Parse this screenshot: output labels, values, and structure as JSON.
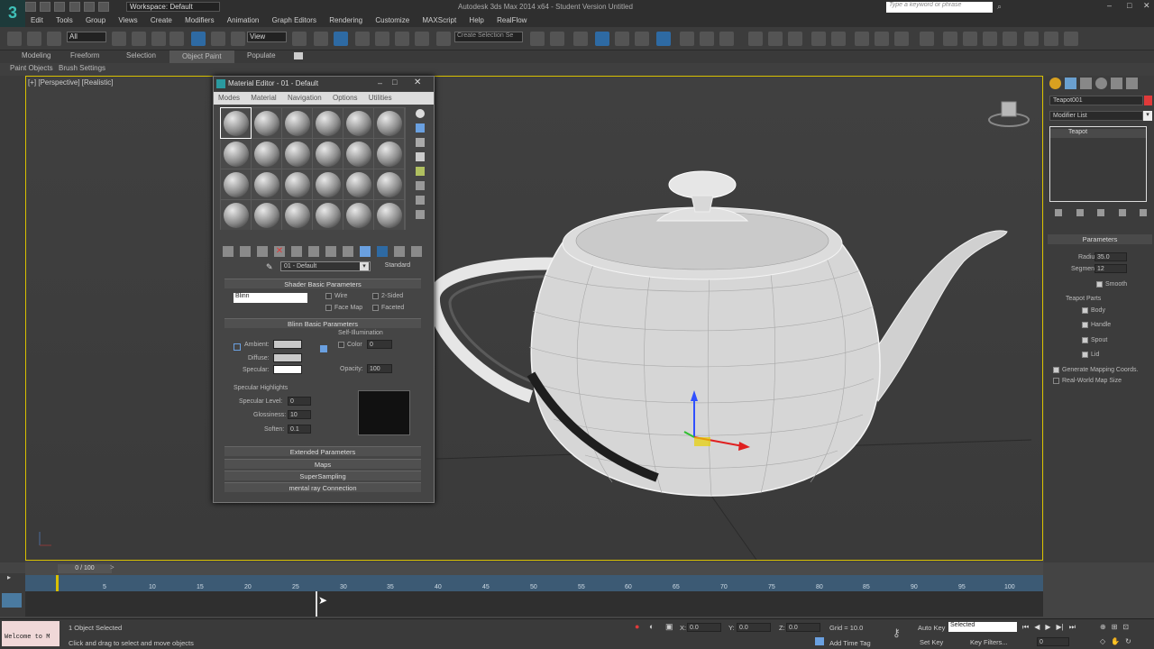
{
  "title": {
    "workspace": "Workspace: Default",
    "app_title": "Autodesk 3ds Max 2014 x64  -  Student Version   Untitled",
    "search_placeholder": "Type a keyword or phrase"
  },
  "menu": [
    "Edit",
    "Tools",
    "Group",
    "Views",
    "Create",
    "Modifiers",
    "Animation",
    "Graph Editors",
    "Rendering",
    "Customize",
    "MAXScript",
    "Help",
    "RealFlow"
  ],
  "toolbar": {
    "filter": "All",
    "refcoord": "View",
    "selection_set": "Create Selection Se"
  },
  "ribbon": {
    "tabs": [
      "Modeling",
      "Freeform",
      "Selection",
      "Object Paint",
      "Populate"
    ],
    "subtabs": [
      "Paint Objects",
      "Brush Settings"
    ]
  },
  "viewport": {
    "label": "[+] [Perspective] [Realistic]"
  },
  "material_editor": {
    "title": "Material Editor - 01 - Default",
    "menu": [
      "Modes",
      "Material",
      "Navigation",
      "Options",
      "Utilities"
    ],
    "material_name": "01 - Default",
    "material_type": "Standard",
    "shader_rollout": "Shader Basic Parameters",
    "shader": "Blinn",
    "wire": "Wire",
    "two_sided": "2-Sided",
    "face_map": "Face Map",
    "faceted": "Faceted",
    "blinn_rollout": "Blinn Basic Parameters",
    "self_illum": "Self-Illumination",
    "color_lbl": "Color",
    "color_val": "0",
    "ambient": "Ambient:",
    "diffuse": "Diffuse:",
    "specular": "Specular:",
    "opacity_lbl": "Opacity:",
    "opacity_val": "100",
    "spec_highlights": "Specular Highlights",
    "spec_level_lbl": "Specular Level:",
    "spec_level": "0",
    "gloss_lbl": "Glossiness:",
    "gloss": "10",
    "soften_lbl": "Soften:",
    "soften": "0.1",
    "rollouts": [
      "Extended Parameters",
      "Maps",
      "SuperSampling",
      "mental ray Connection"
    ]
  },
  "command_panel": {
    "object_name": "Teapot001",
    "modifier_list": "Modifier List",
    "stack_item": "Teapot",
    "params_title": "Parameters",
    "radius_lbl": "Radius:",
    "radius": "35.0",
    "segments_lbl": "Segments:",
    "segments": "12",
    "smooth": "Smooth",
    "parts_title": "Teapot Parts",
    "parts": [
      "Body",
      "Handle",
      "Spout",
      "Lid"
    ],
    "gen_map": "Generate Mapping Coords.",
    "real_world": "Real-World Map Size",
    "object_color": "#e03a3a"
  },
  "timeline": {
    "frame": "0 / 100",
    "ticks": [
      "5",
      "10",
      "15",
      "20",
      "25",
      "30",
      "35",
      "40",
      "45",
      "50",
      "55",
      "60",
      "65",
      "70",
      "75",
      "80",
      "85",
      "90",
      "95",
      "100"
    ]
  },
  "status": {
    "maxscript": "Welcome to M",
    "selected": "1 Object Selected",
    "prompt": "Click and drag to select and move objects",
    "x_lbl": "X:",
    "x": "0.0",
    "y_lbl": "Y:",
    "y": "0.0",
    "z_lbl": "Z:",
    "z": "0.0",
    "grid": "Grid = 10.0",
    "add_time_tag": "Add Time Tag",
    "auto_key": "Auto Key",
    "set_key": "Set Key",
    "key_mode": "Selected",
    "key_filters": "Key Filters...",
    "frame_field": "0"
  }
}
